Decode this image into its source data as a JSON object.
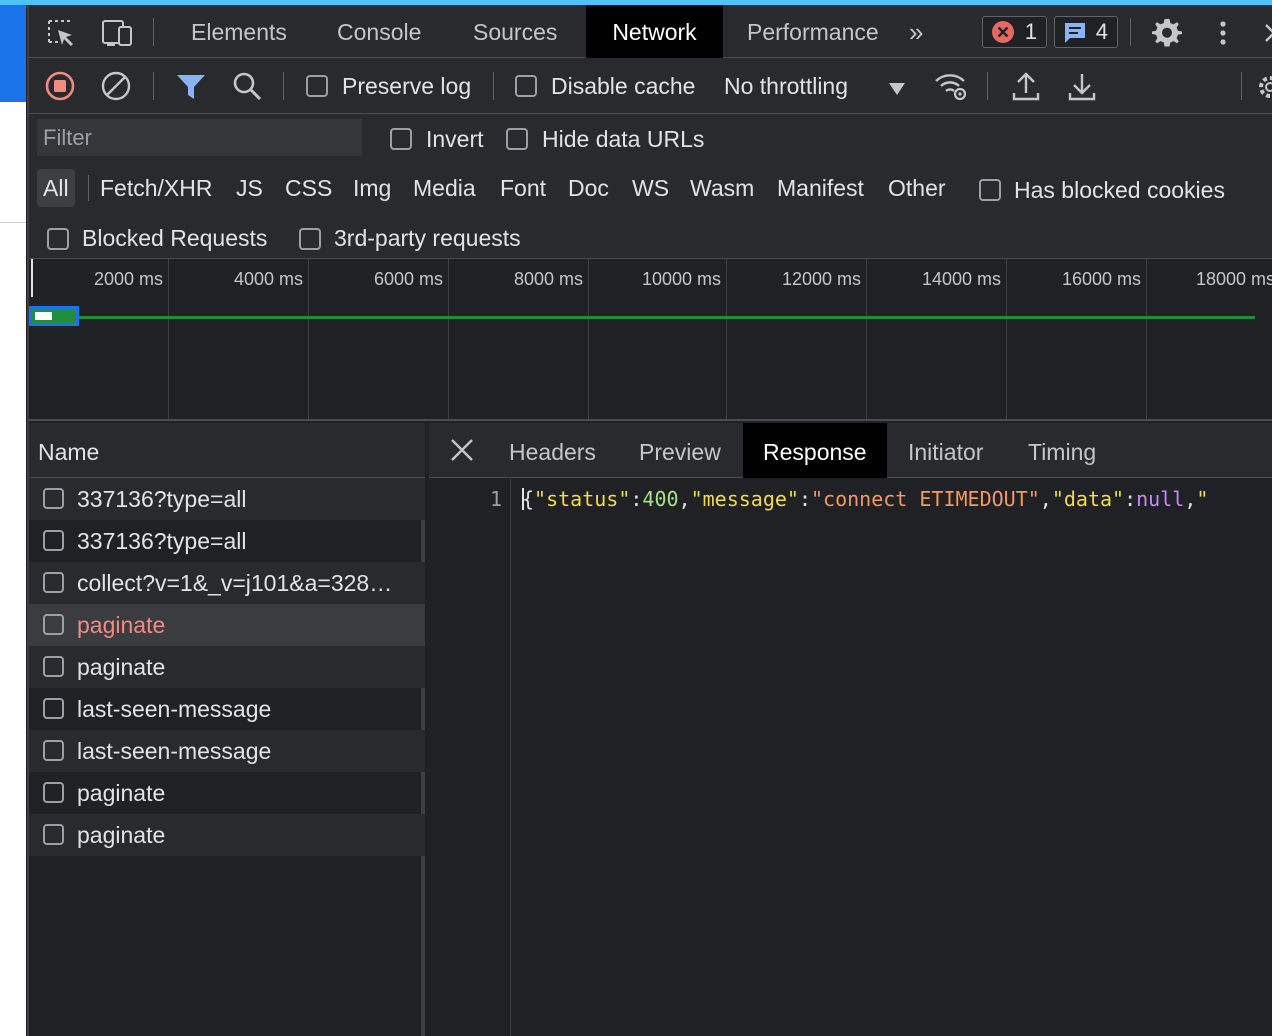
{
  "devtools": {
    "tabs": [
      {
        "label": "Elements"
      },
      {
        "label": "Console"
      },
      {
        "label": "Sources"
      },
      {
        "label": "Network"
      },
      {
        "label": "Performance"
      }
    ],
    "active_tab": "Network",
    "overflow_glyph": "»",
    "error_count": "1",
    "message_count": "4"
  },
  "toolbar": {
    "preserve_log": "Preserve log",
    "disable_cache": "Disable cache",
    "throttling": "No throttling"
  },
  "filters": {
    "filter_placeholder": "Filter",
    "invert": "Invert",
    "hide_data_urls": "Hide data URLs",
    "types": [
      "All",
      "Fetch/XHR",
      "JS",
      "CSS",
      "Img",
      "Media",
      "Font",
      "Doc",
      "WS",
      "Wasm",
      "Manifest",
      "Other"
    ],
    "has_blocked_cookies": "Has blocked cookies",
    "blocked_requests": "Blocked Requests",
    "third_party": "3rd-party requests"
  },
  "overview": {
    "ticks": [
      "2000 ms",
      "4000 ms",
      "6000 ms",
      "8000 ms",
      "10000 ms",
      "12000 ms",
      "14000 ms",
      "16000 ms",
      "18000 ms"
    ]
  },
  "requests": {
    "header": "Name",
    "rows": [
      {
        "name": "337136?type=all"
      },
      {
        "name": "337136?type=all"
      },
      {
        "name": "collect?v=1&_v=j101&a=328…"
      },
      {
        "name": "paginate"
      },
      {
        "name": "paginate"
      },
      {
        "name": "last-seen-message"
      },
      {
        "name": "last-seen-message"
      },
      {
        "name": "paginate"
      },
      {
        "name": "paginate"
      }
    ]
  },
  "detail": {
    "tabs": [
      "Headers",
      "Preview",
      "Response",
      "Initiator",
      "Timing"
    ],
    "active_tab": "Response",
    "line_number": "1",
    "response": {
      "open": "{",
      "key_status": "\"status\"",
      "colon1": ":",
      "status_value": "400",
      "comma1": ",",
      "key_message": "\"message\"",
      "colon2": ":",
      "message_value": "\"connect ETIMEDOUT\"",
      "comma2": ",",
      "key_data": "\"data\"",
      "colon3": ":",
      "data_value": "null",
      "comma3": ",",
      "tail": "\""
    }
  },
  "colors": {
    "accent": "#1a73e8",
    "error_text": "#f28b82",
    "record_red": "#f28b82",
    "timeline_green": "#1e8e3e"
  }
}
